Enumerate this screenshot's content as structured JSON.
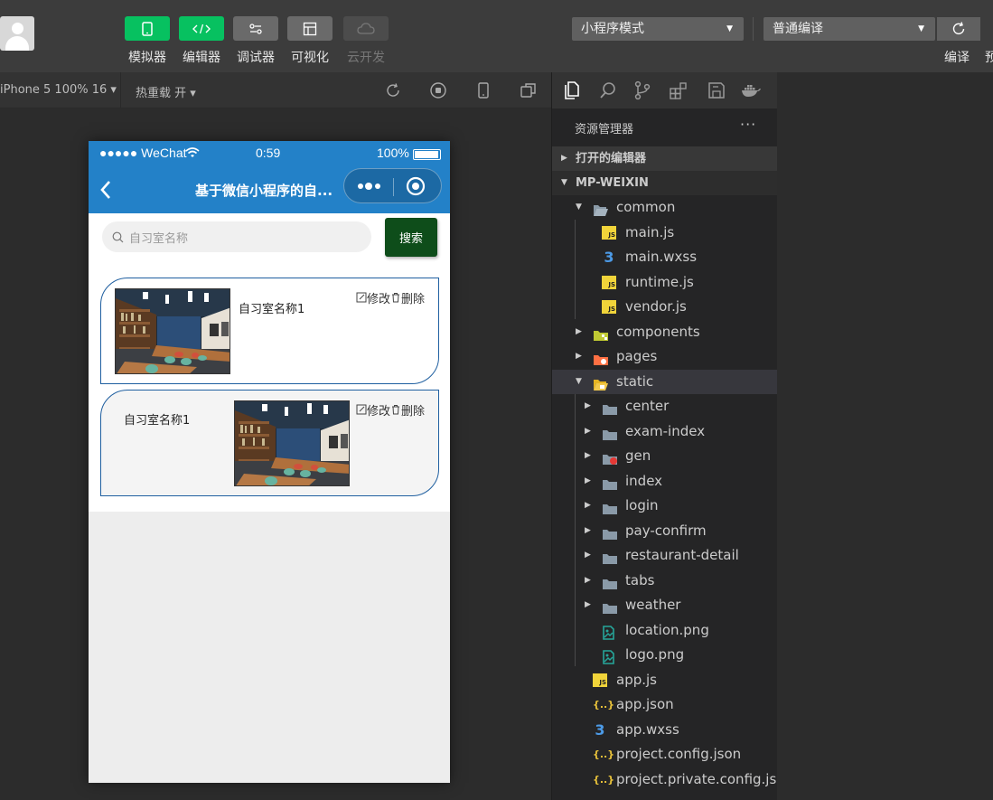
{
  "toolbar": {
    "buttons": [
      {
        "label": "模拟器",
        "icon": "phone-icon"
      },
      {
        "label": "编辑器",
        "icon": "code-icon"
      },
      {
        "label": "调试器",
        "icon": "debug-icon"
      },
      {
        "label": "可视化",
        "icon": "layout-icon"
      },
      {
        "label": "云开发",
        "icon": "cloud-icon"
      }
    ],
    "mode_select": "小程序模式",
    "compile_select": "普通编译",
    "compile_label": "编译",
    "cut_label": "预"
  },
  "simulator": {
    "device": "iPhone 5 100% 16 ▾",
    "hot_reload": "热重载 开 ▾"
  },
  "phone": {
    "status": {
      "carrier": "●●●●● WeChat",
      "time": "0:59",
      "battery": "100%"
    },
    "nav_title": "基于微信小程序的自...",
    "search_placeholder": "自习室名称",
    "search_button": "搜索",
    "cards": [
      {
        "name": "自习室名称1",
        "edit": "修改",
        "delete": "删除"
      },
      {
        "name": "自习室名称1",
        "edit": "修改",
        "delete": "删除"
      }
    ]
  },
  "explorer": {
    "title": "资源管理器",
    "more": "···",
    "open_editors": "打开的编辑器",
    "project": "MP-WEIXIN",
    "tree": [
      {
        "label": "common",
        "type": "folder-open",
        "depth": 0,
        "arrow": "down"
      },
      {
        "label": "main.js",
        "type": "js",
        "depth": 1
      },
      {
        "label": "main.wxss",
        "type": "css",
        "depth": 1
      },
      {
        "label": "runtime.js",
        "type": "js",
        "depth": 1
      },
      {
        "label": "vendor.js",
        "type": "js",
        "depth": 1
      },
      {
        "label": "components",
        "type": "folder-components",
        "depth": 0,
        "arrow": "right"
      },
      {
        "label": "pages",
        "type": "folder-pages",
        "depth": 0,
        "arrow": "right"
      },
      {
        "label": "static",
        "type": "folder-static",
        "depth": 0,
        "arrow": "down",
        "selected": true
      },
      {
        "label": "center",
        "type": "folder",
        "depth": 1,
        "arrow": "right"
      },
      {
        "label": "exam-index",
        "type": "folder",
        "depth": 1,
        "arrow": "right"
      },
      {
        "label": "gen",
        "type": "folder-gen",
        "depth": 1,
        "arrow": "right"
      },
      {
        "label": "index",
        "type": "folder",
        "depth": 1,
        "arrow": "right"
      },
      {
        "label": "login",
        "type": "folder",
        "depth": 1,
        "arrow": "right"
      },
      {
        "label": "pay-confirm",
        "type": "folder",
        "depth": 1,
        "arrow": "right"
      },
      {
        "label": "restaurant-detail",
        "type": "folder",
        "depth": 1,
        "arrow": "right"
      },
      {
        "label": "tabs",
        "type": "folder",
        "depth": 1,
        "arrow": "right"
      },
      {
        "label": "weather",
        "type": "folder",
        "depth": 1,
        "arrow": "right"
      },
      {
        "label": "location.png",
        "type": "png",
        "depth": 1
      },
      {
        "label": "logo.png",
        "type": "png",
        "depth": 1
      },
      {
        "label": "app.js",
        "type": "js",
        "depth": 0
      },
      {
        "label": "app.json",
        "type": "json",
        "depth": 0
      },
      {
        "label": "app.wxss",
        "type": "css",
        "depth": 0
      },
      {
        "label": "project.config.json",
        "type": "json",
        "depth": 0
      },
      {
        "label": "project.private.config.js...",
        "type": "json",
        "depth": 0
      }
    ]
  },
  "colors": {
    "accent_green": "#07c160",
    "nav_blue": "#2381c8",
    "search_btn": "#0e4d1a"
  }
}
